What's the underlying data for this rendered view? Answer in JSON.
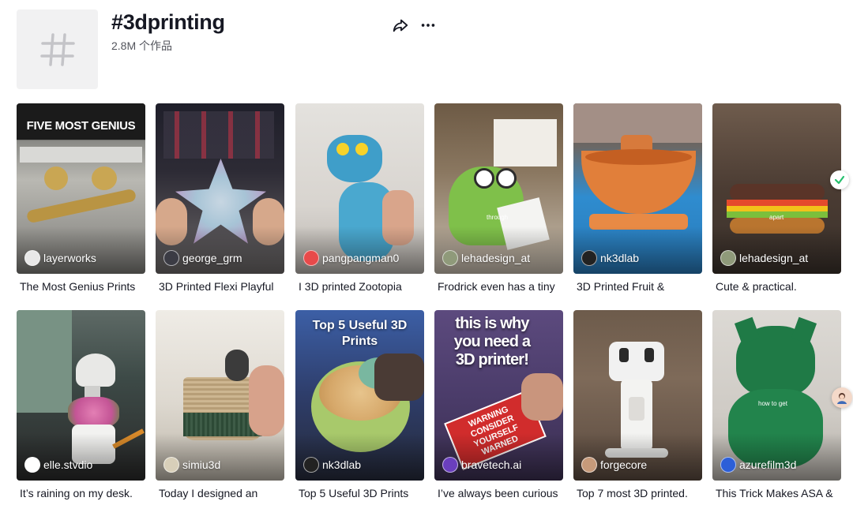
{
  "header": {
    "hashtag": "#3dprinting",
    "post_count": "2.8M 个作品"
  },
  "colors": {
    "text": "#161823",
    "placeholder": "#f1f1f2"
  },
  "videos": [
    {
      "author": "layerworks",
      "caption": "The Most Genius Prints",
      "overlay": "FIVE MOST GENIUS"
    },
    {
      "author": "george_grm",
      "caption": "3D Printed Flexi Playful"
    },
    {
      "author": "pangpangman0",
      "caption": "I 3D printed Zootopia"
    },
    {
      "author": "lehadesign_at",
      "caption": "Frodrick even has a tiny",
      "overlay": "through"
    },
    {
      "author": "nk3dlab",
      "caption": "3D Printed Fruit &"
    },
    {
      "author": "lehadesign_at",
      "caption": "Cute & practical.",
      "overlay": "apart"
    },
    {
      "author": "elle.stvdio",
      "caption": "It’s raining on my desk."
    },
    {
      "author": "simiu3d",
      "caption": "Today I designed an"
    },
    {
      "author": "nk3dlab",
      "caption": "Top 5 Useful 3D Prints",
      "overlay": "Top 5 Useful 3D Prints"
    },
    {
      "author": "bravetech.ai",
      "caption": "I’ve always been curious",
      "overlay": "this is why you need a 3D printer!",
      "sign": "WARNING CONSIDER YOURSELF WARNED"
    },
    {
      "author": "forgecore",
      "caption": "Top 7 most 3D printed."
    },
    {
      "author": "azurefilm3d",
      "caption": "This Trick Makes ASA &",
      "overlay": "how to get"
    }
  ]
}
